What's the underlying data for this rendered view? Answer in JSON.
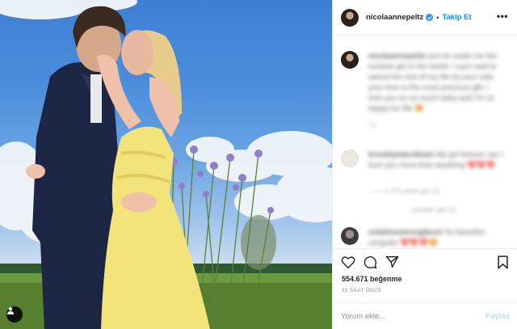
{
  "post": {
    "username": "nicolaannepeltz",
    "follow_label": "Takip Et",
    "separator": "•",
    "more_label": "•••",
    "likes": "554.671 beğenme",
    "time": "22 SAAT ÖNCE"
  },
  "comments": [
    {
      "username": "nicolaannepeltz",
      "text": "you've made me the luckiest girl in the world. I can't wait to spend the rest of my life by your side. your love is the most precious gift, I love you so so much baby and I'm so happy for life 😍",
      "avatar_color": "#2a211d",
      "meta": "1g"
    },
    {
      "username": "brooklynbeckham",
      "text": "My girl forever can I love you more than anything ❤️❤️❤️",
      "avatar_color": "#d9d4cc",
      "meta": "—— 1.473 yanıtı gör",
      "hearts": "❤❤❤"
    },
    {
      "username": "nobleinsetrengthonl",
      "text": "So beautiful congrats ❤️❤️❤️😍",
      "avatar_color": "#4a4446",
      "hearts": "❤❤"
    }
  ],
  "view_replies": "——  1.473 yanıtı gör (1)",
  "load_more": "yanıtları gör (1)",
  "comment_box": {
    "placeholder": "Yorum ekle...",
    "post_label": "Paylaş"
  },
  "icons": [
    "heart-icon",
    "comment-icon",
    "share-icon",
    "bookmark-icon",
    "user-tag-icon",
    "verified-badge-icon",
    "more-options-icon"
  ],
  "colors": {
    "accent": "#0095f6",
    "verified": "#3897f0",
    "muted": "#8e8e8e",
    "dress": "#f2e37a",
    "suit": "#1c2541"
  }
}
